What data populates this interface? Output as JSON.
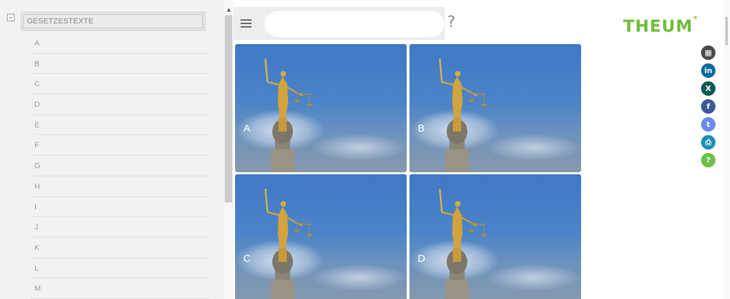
{
  "tree": {
    "root_label": "GESETZESTEXTE",
    "items": [
      "A",
      "B",
      "C",
      "D",
      "E",
      "F",
      "G",
      "H",
      "I",
      "J",
      "K",
      "L",
      "M"
    ]
  },
  "toolbar": {
    "search_placeholder": "",
    "help_text": "?"
  },
  "brand": {
    "logo_text": "THEUM",
    "logo_mark": "®",
    "color": "#6fbd3b"
  },
  "tiles": [
    {
      "label": "A"
    },
    {
      "label": "B"
    },
    {
      "label": "C"
    },
    {
      "label": "D"
    }
  ],
  "social": [
    {
      "name": "calendar-icon",
      "glyph": "▦",
      "color": "#4a4a4a"
    },
    {
      "name": "linkedin-icon",
      "glyph": "in",
      "color": "#0a6aa5"
    },
    {
      "name": "xing-icon",
      "glyph": "X",
      "color": "#0b5a55"
    },
    {
      "name": "facebook-icon",
      "glyph": "f",
      "color": "#3b5998"
    },
    {
      "name": "twitter-icon",
      "glyph": "t",
      "color": "#6a8cf0"
    },
    {
      "name": "print-icon",
      "glyph": "⎙",
      "color": "#1a8fb8"
    },
    {
      "name": "help-icon",
      "glyph": "?",
      "color": "#6cc04a"
    }
  ]
}
